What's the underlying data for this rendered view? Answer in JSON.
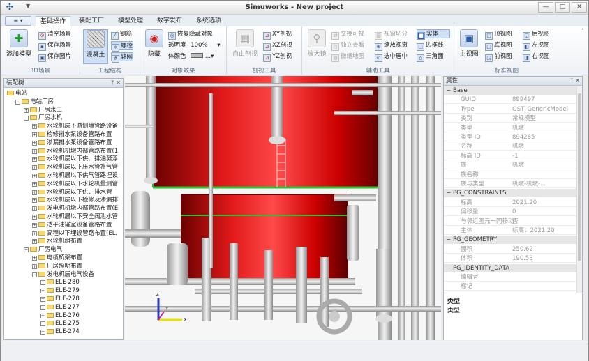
{
  "window": {
    "title": "Simuworks - New project",
    "min": "—",
    "max": "□",
    "close": "✕"
  },
  "tabs": [
    "基础操作",
    "装配工厂",
    "模型处理",
    "数字发布",
    "系统选项"
  ],
  "app_menu": "≡ ▾",
  "ribbon": {
    "scene": {
      "label": "3D场景",
      "add": "添加模型",
      "clear": "清空场景",
      "save": "保存场景",
      "save_img": "保存图片"
    },
    "struct": {
      "label": "工程结构",
      "concrete": "混凝土",
      "rebar": "钢筋",
      "bolt": "螺栓",
      "grid": "轴网"
    },
    "effect": {
      "label": "对象效果",
      "hide": "隐藏",
      "restore": "恢复隐藏对象",
      "opacity": "透明度",
      "opacity_val": "100%",
      "color": "体颜色",
      "color_val": "..."
    },
    "section": {
      "label": "剖视工具",
      "free": "自由剖视",
      "xy": "XY剖视",
      "xz": "XZ剖视",
      "yz": "YZ剖视"
    },
    "assist": {
      "label": "辅助工具",
      "magnify": "放大镜",
      "swap": "交换可视",
      "isolate": "独立查看",
      "micro": "微缩地图",
      "view_cut": "视窗切分",
      "zoom_view": "缩放视窗",
      "center": "选中居中",
      "solid": "实体",
      "edge": "边框线",
      "tri": "三角面"
    },
    "std": {
      "label": "标准视图",
      "main": "主视图",
      "top": "顶视图",
      "back": "后视图",
      "bottom": "底视图",
      "left": "左视图",
      "front": "前视图",
      "right": "右视图"
    }
  },
  "tree_panel": {
    "title": "装配树",
    "pin": "ᛘ ✕"
  },
  "tree": [
    {
      "label": "电站",
      "depth": 0,
      "exp": ""
    },
    {
      "label": "电站厂房",
      "depth": 1,
      "exp": "-"
    },
    {
      "label": "厂房水工",
      "depth": 2,
      "exp": "+"
    },
    {
      "label": "厂房水机",
      "depth": 2,
      "exp": "-"
    },
    {
      "label": "水轮机层下游侧墙管路设备",
      "depth": 3,
      "exp": "+"
    },
    {
      "label": "检修排水泵设备管路布置",
      "depth": 3,
      "exp": "+"
    },
    {
      "label": "渗漏排水泵设备管路布置",
      "depth": 3,
      "exp": "+"
    },
    {
      "label": "水轮机机墩内部管路布置(1",
      "depth": 3,
      "exp": "+"
    },
    {
      "label": "水轮机层以下供、排油凝浮",
      "depth": 3,
      "exp": "+"
    },
    {
      "label": "水轮机层以下压水管补气管",
      "depth": 3,
      "exp": "+"
    },
    {
      "label": "水轮机层以下供气管路埋设",
      "depth": 3,
      "exp": "+"
    },
    {
      "label": "水轮机层以下水轮机量测管",
      "depth": 3,
      "exp": "+"
    },
    {
      "label": "水轮机层以下供、排水管",
      "depth": 3,
      "exp": "+"
    },
    {
      "label": "水轮机层以下检修及渗漏排",
      "depth": 3,
      "exp": "+"
    },
    {
      "label": "发电机机墩内部管路布置(E",
      "depth": 3,
      "exp": "+"
    },
    {
      "label": "水轮机层以下安全阀泄水管",
      "depth": 3,
      "exp": "+"
    },
    {
      "label": "透平油罐室设备管路布置",
      "depth": 3,
      "exp": "+"
    },
    {
      "label": "高程以下埋设管路布置(EL.",
      "depth": 3,
      "exp": "+"
    },
    {
      "label": "水轮机组布置",
      "depth": 3,
      "exp": "+"
    },
    {
      "label": "厂房电气",
      "depth": 2,
      "exp": "-"
    },
    {
      "label": "电缆桥架布置",
      "depth": 3,
      "exp": "+"
    },
    {
      "label": "厂房照明布置",
      "depth": 3,
      "exp": "+"
    },
    {
      "label": "发电机层电气设备",
      "depth": 3,
      "exp": "-"
    },
    {
      "label": "ELE-280",
      "depth": 4,
      "exp": "+"
    },
    {
      "label": "ELE-279",
      "depth": 4,
      "exp": "+"
    },
    {
      "label": "ELE-278",
      "depth": 4,
      "exp": "+"
    },
    {
      "label": "ELE-277",
      "depth": 4,
      "exp": "+"
    },
    {
      "label": "ELE-276",
      "depth": 4,
      "exp": "+"
    },
    {
      "label": "ELE-275",
      "depth": 4,
      "exp": "+"
    },
    {
      "label": "ELE-274",
      "depth": 4,
      "exp": "+"
    }
  ],
  "props_panel": {
    "title": "属性",
    "pin": "ᛘ ✕"
  },
  "props": [
    {
      "cat": "Base"
    },
    {
      "k": "GUID",
      "v": "899497"
    },
    {
      "k": "Type",
      "v": "OST_GenericModel"
    },
    {
      "k": "类别",
      "v": "常规模型"
    },
    {
      "k": "类型",
      "v": "机墩"
    },
    {
      "k": "类型 ID",
      "v": "894285"
    },
    {
      "k": "名称",
      "v": "机墩"
    },
    {
      "k": "标高 ID",
      "v": "-1"
    },
    {
      "k": "族",
      "v": "机墩"
    },
    {
      "k": "族名称",
      "v": ""
    },
    {
      "k": "族与类型",
      "v": "机墩-机墩-..."
    },
    {
      "cat": "PG_CONSTRAINTS"
    },
    {
      "k": "标高",
      "v": "2021.20"
    },
    {
      "k": "偏移量",
      "v": "0"
    },
    {
      "k": "与邻近图元一同移动",
      "v": "否"
    },
    {
      "k": "主体",
      "v": "标高：2021.20"
    },
    {
      "cat": "PG_GEOMETRY"
    },
    {
      "k": "面积",
      "v": "250.62"
    },
    {
      "k": "体积",
      "v": "190.53"
    },
    {
      "cat": "PG_IDENTITY_DATA"
    },
    {
      "k": "编辑者",
      "v": ""
    },
    {
      "k": "标记",
      "v": ""
    }
  ],
  "desc": {
    "title": "类型",
    "text": "类型"
  },
  "axis": {
    "x": "X",
    "y": "Y",
    "z": "Z"
  },
  "colors": {
    "vessel": "#d81414",
    "highlight": "#2fbf2f",
    "pipe": "#d7d7d7"
  }
}
